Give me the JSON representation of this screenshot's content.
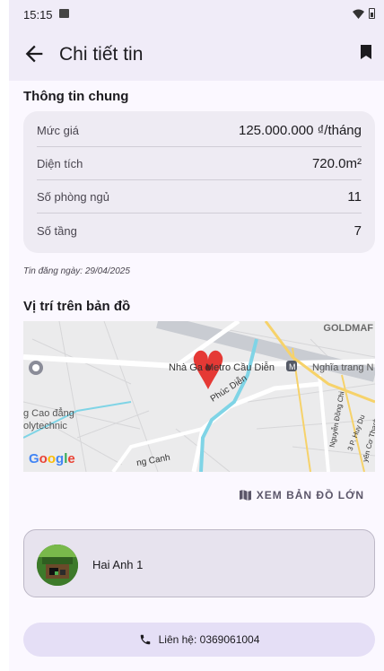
{
  "status_bar": {
    "time": "15:15"
  },
  "app_bar": {
    "title": "Chi tiết tin"
  },
  "general": {
    "title": "Thông tin chung",
    "rows": [
      {
        "label": "Mức giá",
        "value": "125.000.000 ₫/tháng"
      },
      {
        "label": "Diện tích",
        "value": "720.0m²"
      },
      {
        "label": "Số phòng ngủ",
        "value": "11"
      },
      {
        "label": "Số tầng",
        "value": "7"
      }
    ]
  },
  "posted_date": "Tin đăng ngày: 29/04/2025",
  "map": {
    "title": "Vị trí trên bản đồ",
    "labels": {
      "goldmark": "GOLDMAF",
      "metro": "Nhà Ga Metro Cầu Diễn",
      "nghia_trang": "Nghĩa trang N",
      "college_1": "g Cao đẳng",
      "college_2": "olytechnic",
      "street_phuc_dien": "Phúc Diễn",
      "street_canh": "ng Canh",
      "street_nguyen": "Nguyễn Đồng Chi",
      "street_huy_du": "3 P. Huy Du",
      "street_co_thach": "yên Cơ Thạch",
      "google": "Google"
    },
    "open_large_label": "XEM BẢN ĐỒ LỚN"
  },
  "seller": {
    "name": "Hai Anh 1"
  },
  "contact": {
    "label": "Liên hệ: 0369061004"
  },
  "colors": {
    "accent": "#5b5669",
    "marker": "#e53935",
    "contact_bg": "#e5dff6"
  }
}
